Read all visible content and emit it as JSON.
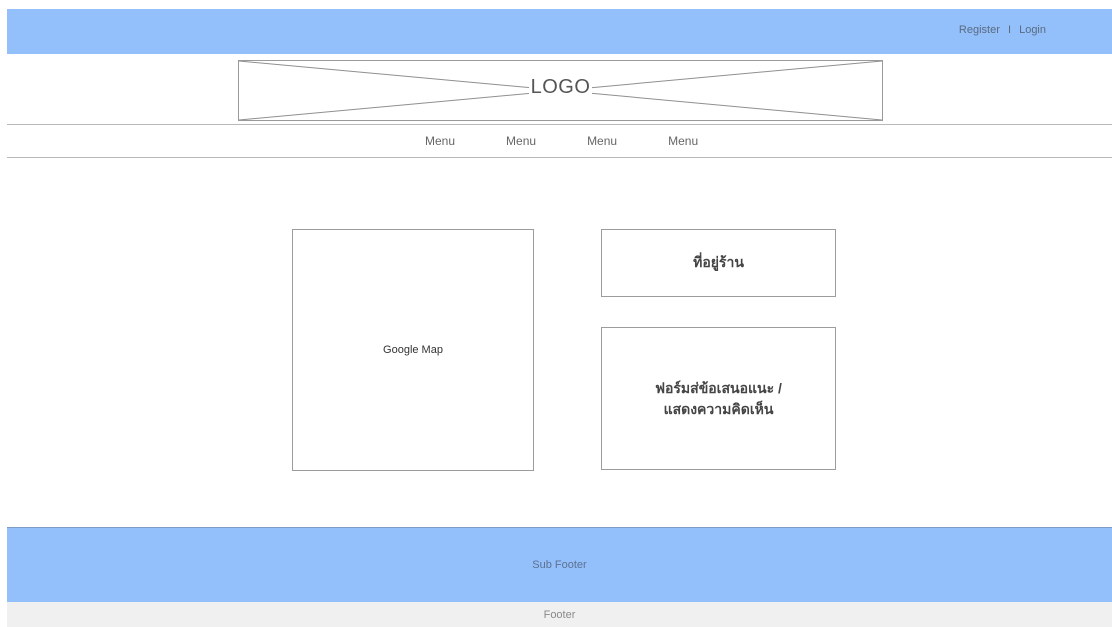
{
  "top_bar": {
    "register_label": "Register",
    "separator": "I",
    "login_label": "Login"
  },
  "header": {
    "logo_label": "LOGO"
  },
  "nav": {
    "items": [
      "Menu",
      "Menu",
      "Menu",
      "Menu"
    ]
  },
  "content": {
    "map_label": "Google Map",
    "address_label": "ที่อยู่ร้าน",
    "form_line1": "ฟอร์มส่ข้อเสนอแนะ /",
    "form_line2": "แสดงความคิดเห็น"
  },
  "sub_footer": {
    "label": "Sub Footer"
  },
  "footer": {
    "label": "Footer"
  },
  "colors": {
    "bar_blue": "#93bffb",
    "border_gray": "#9c9c9c",
    "footer_gray": "#f0f0f0"
  }
}
